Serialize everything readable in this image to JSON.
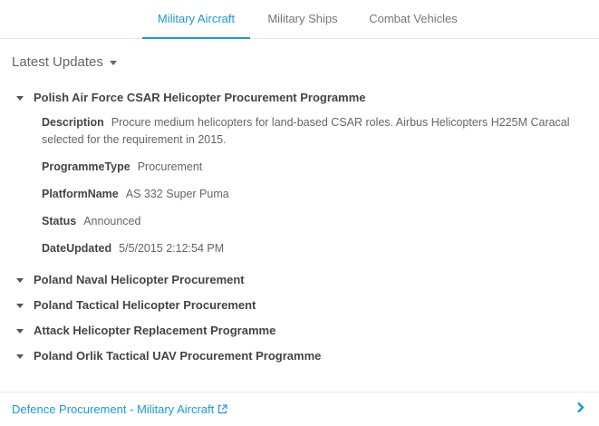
{
  "tabs": [
    {
      "label": "Military Aircraft",
      "active": true
    },
    {
      "label": "Military Ships",
      "active": false
    },
    {
      "label": "Combat Vehicles",
      "active": false
    }
  ],
  "section": {
    "title": "Latest Updates",
    "icon": "caret-down-icon"
  },
  "items": [
    {
      "title": "Polish Air Force CSAR Helicopter Procurement Programme",
      "expanded": true,
      "details": [
        {
          "key": "Description",
          "value": "Procure medium helicopters for land-based CSAR roles. Airbus Helicopters H225M Caracal selected for the requirement in 2015."
        },
        {
          "key": "ProgrammeType",
          "value": "Procurement"
        },
        {
          "key": "PlatformName",
          "value": "AS 332 Super Puma"
        },
        {
          "key": "Status",
          "value": "Announced"
        },
        {
          "key": "DateUpdated",
          "value": "5/5/2015 2:12:54 PM"
        }
      ]
    },
    {
      "title": "Poland Naval Helicopter Procurement",
      "expanded": false
    },
    {
      "title": "Poland Tactical Helicopter Procurement",
      "expanded": false
    },
    {
      "title": "Attack Helicopter Replacement Programme",
      "expanded": false
    },
    {
      "title": "Poland Orlik Tactical UAV Procurement Programme",
      "expanded": false
    }
  ],
  "footer": {
    "link_label": "Defence Procurement - Military Aircraft",
    "link_icon": "external-link-icon",
    "next_icon": "chevron-right-icon"
  },
  "colors": {
    "accent": "#1a9ad6"
  }
}
